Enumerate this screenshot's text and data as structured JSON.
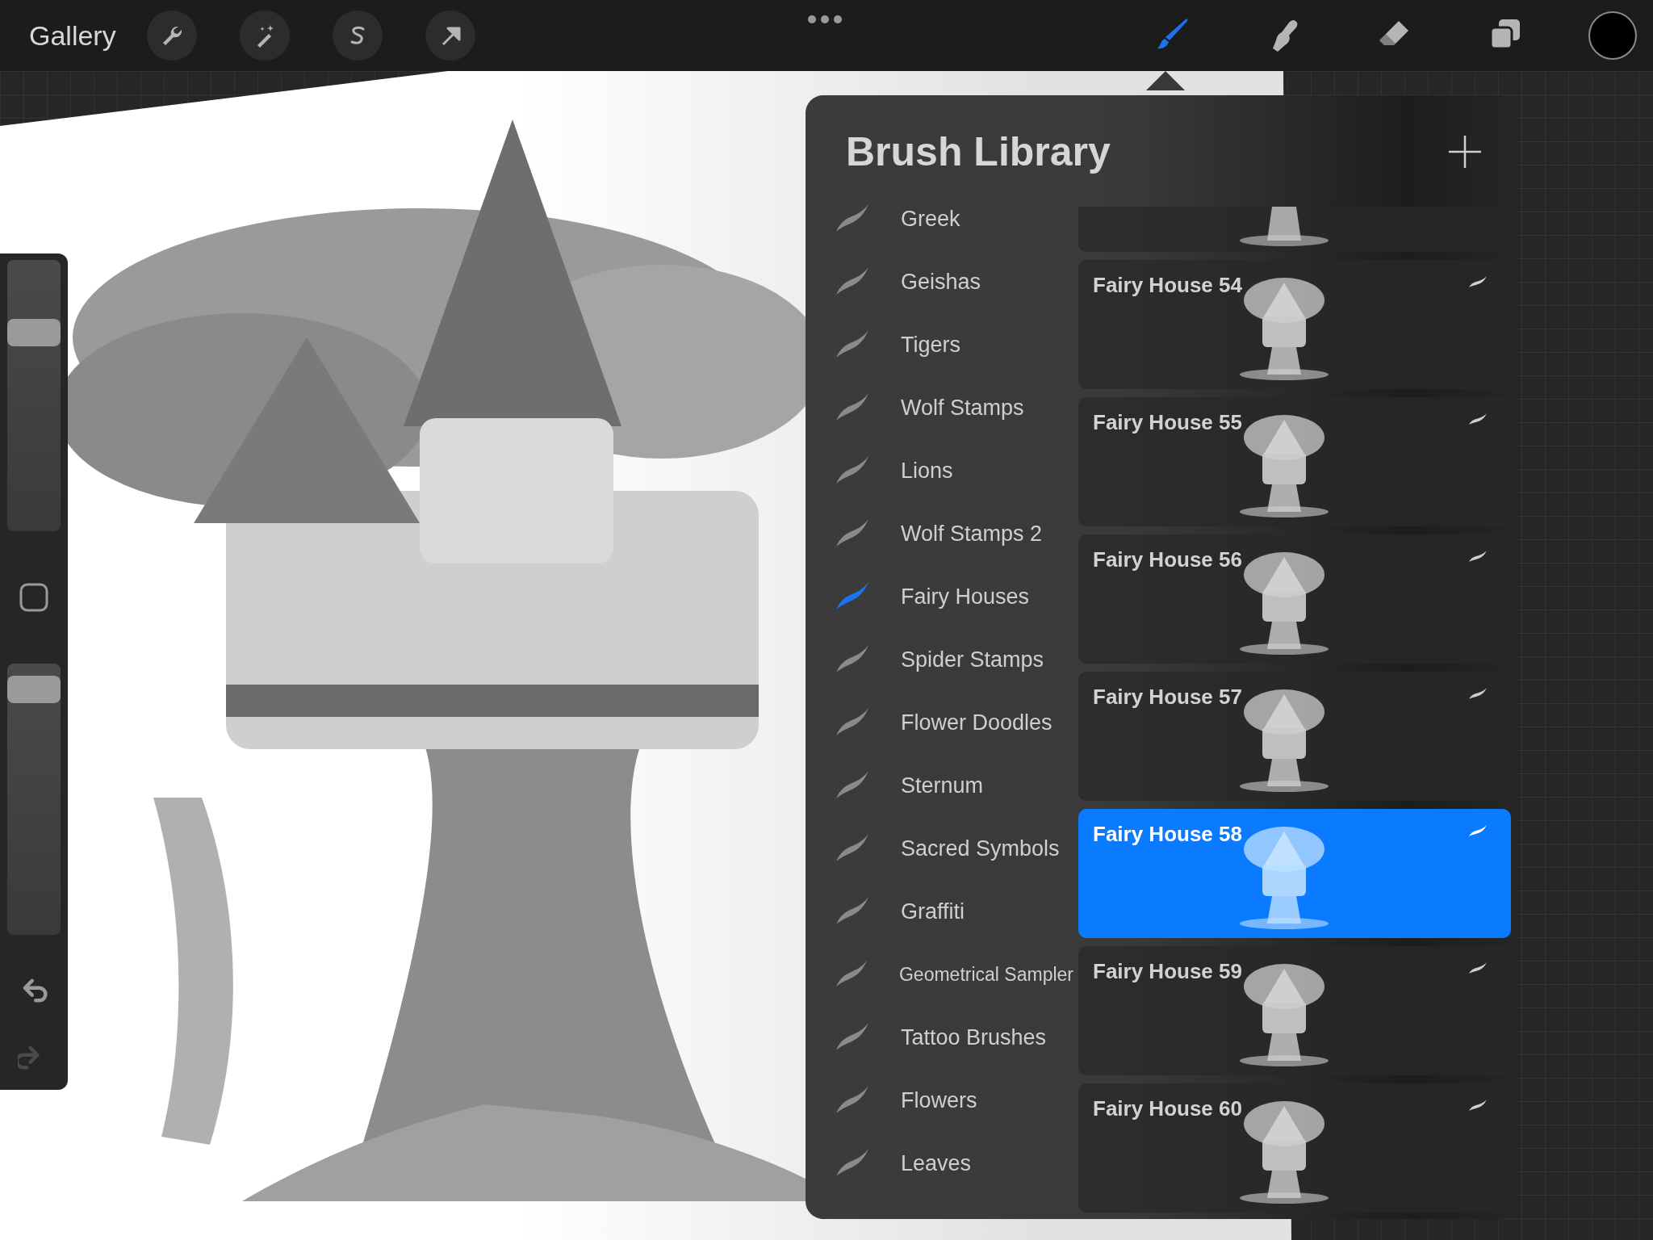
{
  "toolbar": {
    "gallery": "Gallery",
    "left_tools": [
      {
        "kind": "wrench"
      },
      {
        "kind": "wand"
      },
      {
        "kind": "selection"
      },
      {
        "kind": "move"
      }
    ],
    "right_tools": [
      {
        "kind": "brush",
        "selected": true
      },
      {
        "kind": "smudge",
        "selected": false
      },
      {
        "kind": "eraser",
        "selected": false
      },
      {
        "kind": "layers",
        "selected": false
      }
    ]
  },
  "sidebar": {
    "size_slider": {
      "level": 0.76
    },
    "opacity_slider": {
      "level": 0.95
    },
    "undo": {
      "disabled": false
    },
    "redo": {
      "disabled": true
    }
  },
  "panel": {
    "title": "Brush Library",
    "sets": [
      {
        "name": "Greek",
        "selected": false
      },
      {
        "name": "Geishas",
        "selected": false
      },
      {
        "name": "Tigers",
        "selected": false
      },
      {
        "name": "Wolf Stamps",
        "selected": false
      },
      {
        "name": "Lions",
        "selected": false
      },
      {
        "name": "Wolf Stamps 2",
        "selected": false
      },
      {
        "name": "Fairy Houses",
        "selected": true
      },
      {
        "name": "Spider Stamps",
        "selected": false
      },
      {
        "name": "Flower Doodles",
        "selected": false
      },
      {
        "name": "Sternum",
        "selected": false
      },
      {
        "name": "Sacred Symbols",
        "selected": false
      },
      {
        "name": "Graffiti",
        "selected": false
      },
      {
        "name": "Geometrical Sampler",
        "selected": false
      },
      {
        "name": "Tattoo Brushes",
        "selected": false
      },
      {
        "name": "Flowers",
        "selected": false
      },
      {
        "name": "Leaves",
        "selected": false
      }
    ],
    "brushes": [
      {
        "name": "Fairy House 54",
        "selected": false
      },
      {
        "name": "Fairy House 55",
        "selected": false
      },
      {
        "name": "Fairy House 56",
        "selected": false
      },
      {
        "name": "Fairy House 57",
        "selected": false
      },
      {
        "name": "Fairy House 58",
        "selected": true
      },
      {
        "name": "Fairy House 59",
        "selected": false
      },
      {
        "name": "Fairy House 60",
        "selected": false
      }
    ]
  }
}
